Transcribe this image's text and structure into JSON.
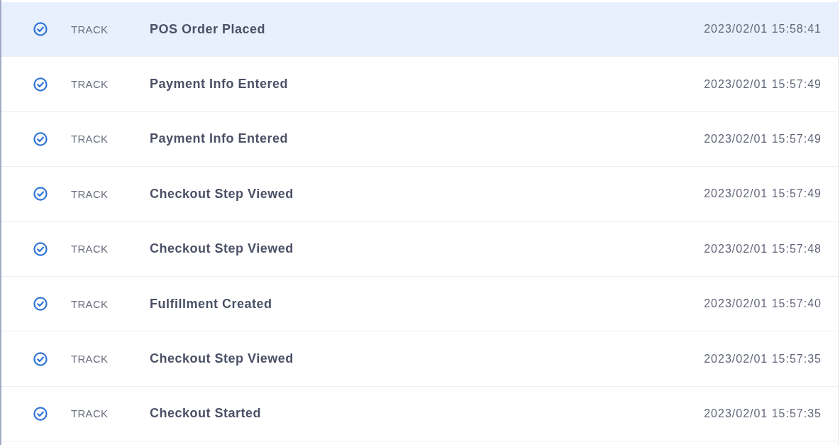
{
  "events": [
    {
      "type": "TRACK",
      "name": "POS Order Placed",
      "timestamp": "2023/02/01 15:58:41",
      "selected": true
    },
    {
      "type": "TRACK",
      "name": "Payment Info Entered",
      "timestamp": "2023/02/01 15:57:49",
      "selected": false
    },
    {
      "type": "TRACK",
      "name": "Payment Info Entered",
      "timestamp": "2023/02/01 15:57:49",
      "selected": false
    },
    {
      "type": "TRACK",
      "name": "Checkout Step Viewed",
      "timestamp": "2023/02/01 15:57:49",
      "selected": false
    },
    {
      "type": "TRACK",
      "name": "Checkout Step Viewed",
      "timestamp": "2023/02/01 15:57:48",
      "selected": false
    },
    {
      "type": "TRACK",
      "name": "Fulfillment Created",
      "timestamp": "2023/02/01 15:57:40",
      "selected": false
    },
    {
      "type": "TRACK",
      "name": "Checkout Step Viewed",
      "timestamp": "2023/02/01 15:57:35",
      "selected": false
    },
    {
      "type": "TRACK",
      "name": "Checkout Started",
      "timestamp": "2023/02/01 15:57:35",
      "selected": false
    }
  ]
}
